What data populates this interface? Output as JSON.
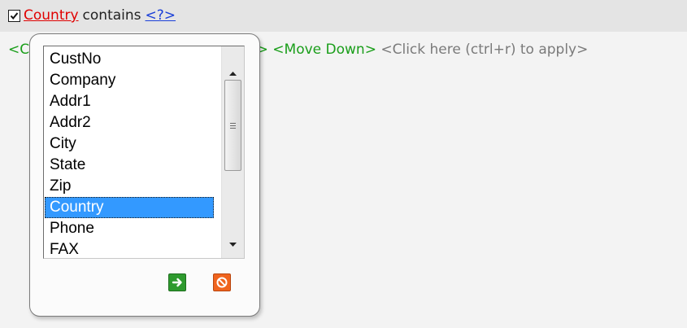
{
  "filter": {
    "checked": true,
    "field": "Country",
    "operator": "contains",
    "value": "<?>"
  },
  "actions": {
    "first_visible": "<C",
    "up_tail": "lp>",
    "move_down": "<Move Down>",
    "apply_hint": "<Click here (ctrl+r) to apply>"
  },
  "field_list": {
    "items": [
      "CustNo",
      "Company",
      "Addr1",
      "Addr2",
      "City",
      "State",
      "Zip",
      "Country",
      "Phone",
      "FAX"
    ],
    "selected": "Country"
  },
  "popup": {
    "ok_icon": "arrow-right-icon",
    "cancel_icon": "prohibit-icon"
  },
  "colors": {
    "field_link": "#e00000",
    "value_link": "#1a3fd8",
    "action_green": "#1a9e1a",
    "selection": "#3399ff"
  }
}
